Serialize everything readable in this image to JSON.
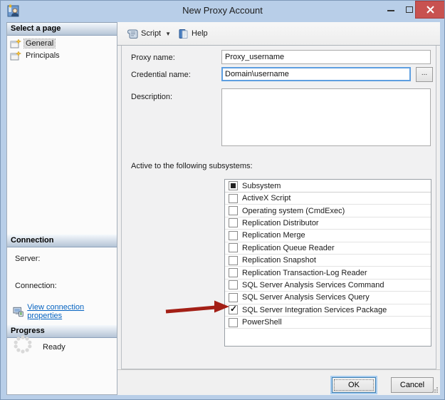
{
  "window": {
    "title": "New Proxy Account"
  },
  "sidebar": {
    "select_header": "Select a page",
    "pages": {
      "general": "General",
      "principals": "Principals"
    },
    "connection_header": "Connection",
    "server_label": "Server:",
    "connection_label": "Connection:",
    "view_link": "View connection properties",
    "progress_header": "Progress",
    "progress_status": "Ready"
  },
  "toolbar": {
    "script_label": "Script",
    "help_label": "Help"
  },
  "form": {
    "proxy_name_label": "Proxy name:",
    "proxy_name_value": "Proxy_username",
    "credential_name_label": "Credential name:",
    "credential_name_value": "Domain\\username",
    "browse_label": "...",
    "description_label": "Description:",
    "description_value": "",
    "subsystems_label": "Active to the following subsystems:"
  },
  "table": {
    "header": "Subsystem",
    "header_checkbox_state": "indeterminate",
    "rows": [
      {
        "label": "ActiveX Script",
        "checked": false
      },
      {
        "label": "Operating system (CmdExec)",
        "checked": false
      },
      {
        "label": "Replication Distributor",
        "checked": false
      },
      {
        "label": "Replication Merge",
        "checked": false
      },
      {
        "label": "Replication Queue Reader",
        "checked": false
      },
      {
        "label": "Replication Snapshot",
        "checked": false
      },
      {
        "label": "Replication Transaction-Log Reader",
        "checked": false
      },
      {
        "label": "SQL Server Analysis Services Command",
        "checked": false
      },
      {
        "label": "SQL Server Analysis Services Query",
        "checked": false
      },
      {
        "label": "SQL Server Integration Services Package",
        "checked": true
      },
      {
        "label": "PowerShell",
        "checked": false
      }
    ],
    "annotated_row": "SQL Server Integration Services Package"
  },
  "buttons": {
    "ok": "OK",
    "cancel": "Cancel"
  },
  "colors": {
    "titlebar": "#b8cee8",
    "close_button": "#c85250",
    "link": "#0563c1",
    "arrow": "#a31f16",
    "focus_border": "#5e9fe0"
  }
}
